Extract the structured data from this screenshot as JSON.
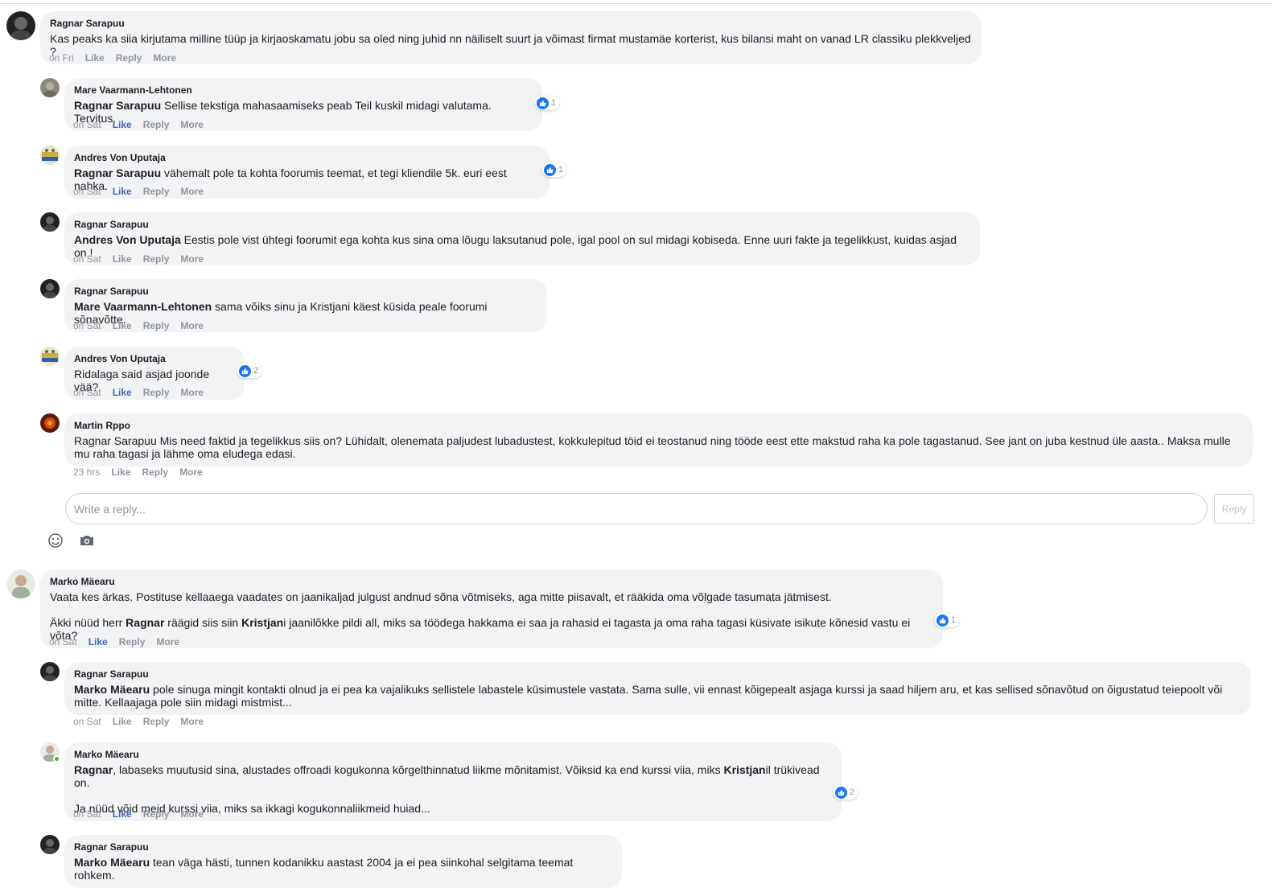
{
  "reply_input": {
    "placeholder": "Write a reply...",
    "button": "Reply"
  },
  "like_color": "#1877f2",
  "comments": [
    {
      "author": "Ragnar Sarapuu",
      "text": "Kas peaks ka siia kirjutama milline tüüp ja kirjaoskamatu jobu sa oled ning juhid nn näiliselt suurt ja võimast firmat mustamäe korterist, kus bilansi maht on vanad LR classiku plekkveljed ?",
      "time": "on Fri",
      "like": "Like",
      "reply": "Reply",
      "more": "More"
    },
    {
      "author": "Mare Vaarmann-Lehtonen",
      "mention": "Ragnar Sarapuu",
      "text": " Sellise tekstiga mahasaamiseks peab Teil kuskil midagi valutama. Tervitus.",
      "reactions": "1",
      "time": "on Sat",
      "like": "Like",
      "reply": "Reply",
      "more": "More"
    },
    {
      "author": "Andres Von Uputaja",
      "mention": "Ragnar Sarapuu",
      "text": " vähemalt pole ta kohta foorumis teemat, et tegi kliendile 5k. euri eest nahka.",
      "reactions": "1",
      "time": "on Sat",
      "like": "Like",
      "reply": "Reply",
      "more": "More"
    },
    {
      "author": "Ragnar Sarapuu",
      "mention": "Andres Von Uputaja",
      "text": " Eestis pole vist ühtegi foorumit ega kohta kus sina oma lõugu laksutanud pole, igal pool on sul midagi kobiseda. Enne uuri fakte ja tegelikkust, kuidas asjad on !",
      "time": "on Sat",
      "like": "Like",
      "reply": "Reply",
      "more": "More"
    },
    {
      "author": "Ragnar Sarapuu",
      "mention": "Mare Vaarmann-Lehtonen",
      "text": " sama võiks sinu ja Kristjani käest küsida peale foorumi sõnavõtte.",
      "time": "on Sat",
      "like": "Like",
      "reply": "Reply",
      "more": "More"
    },
    {
      "author": "Andres Von Uputaja",
      "text": "Ridalaga said asjad joonde vää?",
      "reactions": "2",
      "time": "on Sat",
      "like": "Like",
      "reply": "Reply",
      "more": "More"
    },
    {
      "author": "Martin Rppo",
      "text": "Ragnar Sarapuu Mis need faktid ja tegelikkus siis on? Lühidalt, olenemata paljudest lubadustest, kokkulepitud töid ei teostanud ning tööde eest ette makstud raha ka pole tagastanud. See jant on juba kestnud üle aasta.. Maksa mulle mu raha tagasi ja lähme oma eludega edasi.",
      "time": "23 hrs",
      "like": "Like",
      "reply": "Reply",
      "more": "More"
    },
    {
      "author": "Marko Mäearu",
      "text": "Vaata kes ärkas. Postituse kellaaega vaadates on jaanikaljad julgust andnud sõna võtmiseks, aga mitte piisavalt, et rääkida oma võlgade tasumata jätmisest.",
      "p2_a": "Äkki nüüd herr ",
      "p2_m1": "Ragnar",
      "p2_b": " räägid siis siin ",
      "p2_m2": "Kristjan",
      "p2_c": "i jaanilõkke pildi all, miks sa töödega hakkama ei saa ja rahasid ei tagasta ja oma raha tagasi küsivate isikute kõnesid vastu ei võta?",
      "reactions": "1",
      "time": "on Sat",
      "like": "Like",
      "reply": "Reply",
      "more": "More"
    },
    {
      "author": "Ragnar Sarapuu",
      "mention": "Marko Mäearu",
      "text": " pole sinuga mingit kontakti olnud ja ei pea ka vajalikuks sellistele labastele küsimustele vastata. Sama sulle, vii ennast kõigepealt asjaga kurssi ja saad hiljem aru, et kas sellised sõnavõtud on õigustatud teiepoolt või mitte. Kellaajaga pole siin midagi mistmist...",
      "time": "on Sat",
      "like": "Like",
      "reply": "Reply",
      "more": "More"
    },
    {
      "author": "Marko Mäearu",
      "mention": "Ragnar",
      "text": ", labaseks muutusid sina, alustades offroadi kogukonna kõrgelthinnatud liikme mõnitamist. Võiksid ka end kurssi viia, miks ",
      "mention2": "Kristjan",
      "text2": "il trükivead on.",
      "p2": "Ja nüüd võid meid kurssi viia, miks sa ikkagi kogukonnaliikmeid huiad...",
      "reactions": "2",
      "time": "on Sat",
      "like": "Like",
      "reply": "Reply",
      "more": "More"
    },
    {
      "author": "Ragnar Sarapuu",
      "mention": "Marko Mäearu",
      "text": " tean väga hästi, tunnen kodanikku aastast 2004 ja ei pea siinkohal selgitama teemat rohkem."
    }
  ]
}
